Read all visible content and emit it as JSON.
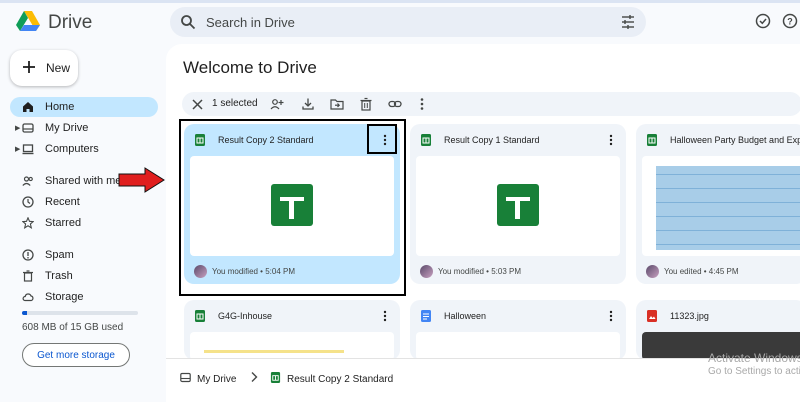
{
  "app": {
    "title": "Drive"
  },
  "search": {
    "placeholder": "Search in Drive"
  },
  "sidebar": {
    "new_label": "New",
    "items": [
      {
        "label": "Home",
        "icon": "home-icon",
        "active": true
      },
      {
        "label": "My Drive",
        "icon": "drive-icon"
      },
      {
        "label": "Computers",
        "icon": "computer-icon"
      },
      {
        "label": "Shared with me",
        "icon": "people-icon"
      },
      {
        "label": "Recent",
        "icon": "clock-icon"
      },
      {
        "label": "Starred",
        "icon": "star-icon"
      },
      {
        "label": "Spam",
        "icon": "spam-icon"
      },
      {
        "label": "Trash",
        "icon": "trash-icon"
      },
      {
        "label": "Storage",
        "icon": "cloud-icon"
      }
    ],
    "storage_text": "608 MB of 15 GB used",
    "storage_fraction": 0.04,
    "get_storage_label": "Get more storage"
  },
  "main": {
    "welcome": "Welcome to Drive",
    "selection_count": "1 selected",
    "cards": [
      {
        "title": "Result Copy 2 Standard",
        "meta": "You modified • 5:04 PM",
        "type": "sheets"
      },
      {
        "title": "Result Copy 1 Standard",
        "meta": "You modified • 5:03 PM",
        "type": "sheets"
      },
      {
        "title": "Halloween Party Budget and Exp",
        "meta": "You edited • 4:45 PM",
        "type": "sheets"
      },
      {
        "title": "G4G-Inhouse",
        "type": "sheets"
      },
      {
        "title": "Halloween",
        "type": "docs"
      },
      {
        "title": "11323.jpg",
        "type": "image"
      }
    ]
  },
  "breadcrumb": {
    "root": "My Drive",
    "current": "Result Copy 2 Standard"
  },
  "watermark": {
    "line1": "Activate Windows",
    "line2": "Go to Settings to activate"
  },
  "colors": {
    "sheets_green": "#188038",
    "active_blue": "#c2e7ff",
    "accent": "#0b57d0",
    "arrow": "#e01e1e"
  }
}
